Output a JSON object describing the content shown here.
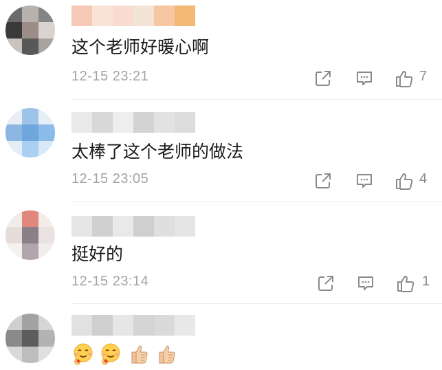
{
  "comments": [
    {
      "text": "这个老师好暖心啊",
      "time": "12-15 23:21",
      "likes": "7",
      "avatar_colors": [
        "#6b6b6b",
        "#b7b2ae",
        "#858585",
        "#3a3a3a",
        "#9c8e86",
        "#d9d4d0",
        "#c8c3bf",
        "#585858",
        "#a9a3a0"
      ],
      "username_colors": [
        "#f6c9b6",
        "#fbe2d6",
        "#fadbd0",
        "#f4e4d8",
        "#f7c7a4",
        "#f3b873"
      ]
    },
    {
      "text": "太棒了这个老师的做法",
      "time": "12-15 23:05",
      "likes": "4",
      "avatar_colors": [
        "#e9eef5",
        "#9ec3e8",
        "#e6eef6",
        "#8cb7e3",
        "#6fa6dd",
        "#8bbbe8",
        "#e3eef8",
        "#aacff0",
        "#d7e8f6"
      ],
      "username_colors": [
        "#e9e9e9",
        "#d8d8d8",
        "#eeeeee",
        "#d3d3d3",
        "#e2e2e2",
        "#dcdcdc"
      ]
    },
    {
      "text": "挺好的",
      "time": "12-15 23:14",
      "likes": "1",
      "avatar_colors": [
        "#f0ecea",
        "#e0877e",
        "#f3ece8",
        "#e6dcda",
        "#8b8088",
        "#e9e2e0",
        "#f5f1ef",
        "#b1a6ad",
        "#f2eeec"
      ],
      "username_colors": [
        "#e6e6e6",
        "#d0d0d0",
        "#e9e9e9",
        "#cfcfcf",
        "#dfdfdf",
        "#e5e5e5"
      ]
    },
    {
      "text": "",
      "time": "",
      "likes": "",
      "avatar_colors": [
        "#cfcfcf",
        "#a2a2a2",
        "#d6d6d6",
        "#8a8a8a",
        "#5c5c5c",
        "#b3b3b3",
        "#d9d9d9",
        "#bdbdbd",
        "#e0e0e0"
      ],
      "username_colors": [
        "#e1e1e1",
        "#cfcfcf",
        "#e6e6e6",
        "#d4d4d4",
        "#dadada",
        "#e8e8e8"
      ]
    }
  ],
  "icons": [
    "share-icon",
    "comment-icon",
    "like-icon"
  ],
  "emoji_row": [
    "hugging-face-emoji",
    "hugging-face-emoji",
    "thumbs-up-emoji",
    "thumbs-up-emoji"
  ],
  "colors": {
    "meta_gray": "#a3a3a3",
    "divider": "#ececec",
    "icon_gray": "#8a8a8a"
  }
}
